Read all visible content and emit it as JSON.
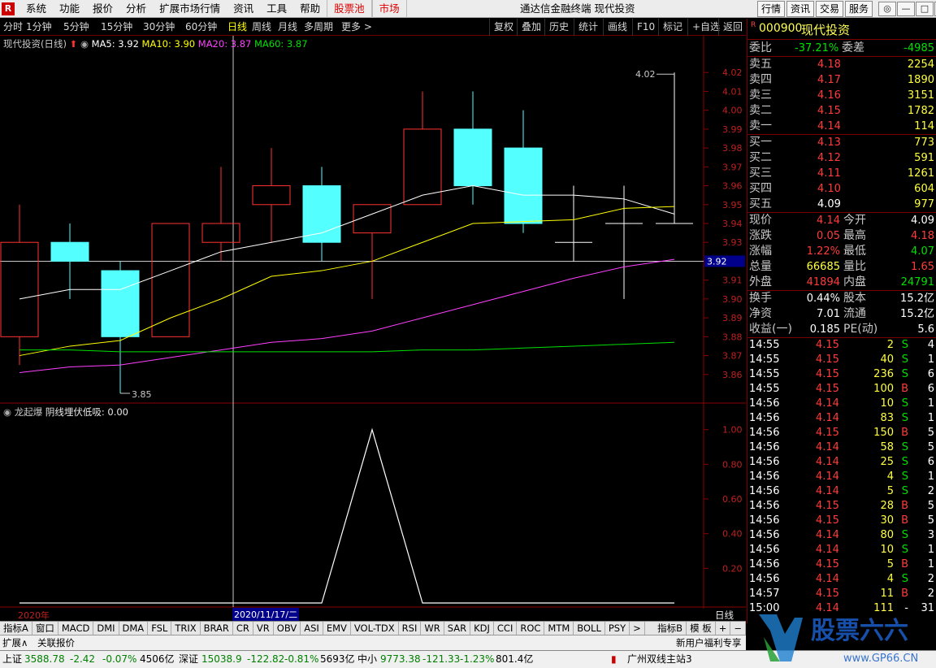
{
  "app": {
    "logo": "R",
    "title": "通达信金融终端  现代投资",
    "menu": [
      "系统",
      "功能",
      "报价",
      "分析",
      "扩展市场行情",
      "资讯",
      "工具",
      "帮助"
    ],
    "menu_red": [
      "股票池",
      "市场"
    ],
    "right_tabs": [
      "行情",
      "资讯",
      "交易",
      "服务"
    ],
    "window_buttons": [
      "◎",
      "—",
      "□",
      "✕"
    ]
  },
  "toolbar": {
    "periods": [
      "分时",
      "1分钟",
      "5分钟",
      "15分钟",
      "30分钟",
      "60分钟",
      "日线",
      "周线",
      "月线",
      "多周期",
      "更多 >"
    ],
    "active_period": "日线",
    "tools": [
      "复权",
      "叠加",
      "历史",
      "统计",
      "画线",
      "F10",
      "标记",
      "+自选",
      "返回"
    ]
  },
  "chart_header": {
    "name": "现代投资(日线)",
    "ma5": "MA5: 3.92",
    "ma10": "MA10: 3.90",
    "ma20": "MA20: 3.87",
    "ma60": "MA60: 3.87",
    "colors": {
      "ma5": "#ffffff",
      "ma10": "#ffff00",
      "ma20": "#ff40ff",
      "ma60": "#00e000",
      "up": "#ff3232",
      "down": "#54ffff"
    }
  },
  "indicator_header": {
    "name": "龙起爆",
    "label": "阴线埋伏低吸: 0.00"
  },
  "chart_data": [
    {
      "type": "candlestick",
      "title": "现代投资(日线)",
      "ylim": [
        3.85,
        4.03
      ],
      "y_ticks": [
        "4.02",
        "4.01",
        "4.00",
        "3.99",
        "3.98",
        "3.97",
        "3.96",
        "3.95",
        "3.94",
        "3.93",
        "3.92",
        "3.91",
        "3.90",
        "3.89",
        "3.88",
        "3.87",
        "3.86"
      ],
      "current_price_label": "3.92",
      "max_label": "4.02",
      "min_label": "3.85",
      "candles": [
        {
          "o": 3.88,
          "h": 3.95,
          "l": 3.865,
          "c": 3.93
        },
        {
          "o": 3.93,
          "h": 3.94,
          "l": 3.9,
          "c": 3.92
        },
        {
          "o": 3.915,
          "h": 3.92,
          "l": 3.85,
          "c": 3.88
        },
        {
          "o": 3.88,
          "h": 3.94,
          "l": 3.88,
          "c": 3.94
        },
        {
          "o": 3.93,
          "h": 3.97,
          "l": 3.92,
          "c": 3.94
        },
        {
          "o": 3.95,
          "h": 3.98,
          "l": 3.93,
          "c": 3.96
        },
        {
          "o": 3.96,
          "h": 3.97,
          "l": 3.92,
          "c": 3.93
        },
        {
          "o": 3.935,
          "h": 3.95,
          "l": 3.9,
          "c": 3.95
        },
        {
          "o": 3.95,
          "h": 4.01,
          "l": 3.95,
          "c": 3.99
        },
        {
          "o": 3.99,
          "h": 4.01,
          "l": 3.95,
          "c": 3.96
        },
        {
          "o": 3.98,
          "h": 4.0,
          "l": 3.935,
          "c": 3.94
        },
        {
          "o": 3.93,
          "h": 3.96,
          "l": 3.92,
          "c": 3.93
        },
        {
          "o": 3.94,
          "h": 3.96,
          "l": 3.9,
          "c": 3.94
        },
        {
          "o": 3.94,
          "h": 4.02,
          "l": 3.94,
          "c": 3.94
        }
      ],
      "ma5": [
        3.9,
        3.905,
        3.905,
        3.915,
        3.925,
        3.93,
        3.935,
        3.945,
        3.955,
        3.96,
        3.955,
        3.955,
        3.953,
        3.945
      ],
      "ma10": [
        3.87,
        3.875,
        3.878,
        3.89,
        3.9,
        3.912,
        3.915,
        3.92,
        3.93,
        3.94,
        3.941,
        3.942,
        3.948,
        3.949
      ],
      "ma20": [
        3.861,
        3.864,
        3.865,
        3.869,
        3.873,
        3.877,
        3.879,
        3.883,
        3.89,
        3.897,
        3.904,
        3.911,
        3.917,
        3.921
      ],
      "ma60": [
        3.873,
        3.873,
        3.872,
        3.872,
        3.872,
        3.872,
        3.872,
        3.872,
        3.873,
        3.873,
        3.874,
        3.875,
        3.876,
        3.877
      ]
    },
    {
      "type": "line",
      "title": "龙起爆",
      "series": [
        {
          "name": "阴线埋伏低吸",
          "values": [
            0,
            0,
            0,
            0,
            0,
            0,
            0,
            1,
            0,
            0,
            0,
            0,
            0,
            0
          ]
        }
      ],
      "ylim": [
        0,
        1.05
      ],
      "y_ticks": [
        "1.00",
        "0.80",
        "0.60",
        "0.40",
        "0.20"
      ]
    }
  ],
  "date_labels": {
    "year": "2020年",
    "cursor_date": "2020/11/17/二",
    "period": "日线"
  },
  "quote": {
    "code": "000900",
    "name": "现代投资",
    "badge": "R",
    "weibi_label": "委比",
    "weibi": "-37.21%",
    "weicha_label": "委差",
    "weicha": "-4985",
    "sell": [
      {
        "label": "卖五",
        "price": "4.18",
        "vol": "2254"
      },
      {
        "label": "卖四",
        "price": "4.17",
        "vol": "1890"
      },
      {
        "label": "卖三",
        "price": "4.16",
        "vol": "3151"
      },
      {
        "label": "卖二",
        "price": "4.15",
        "vol": "1782"
      },
      {
        "label": "卖一",
        "price": "4.14",
        "vol": "114"
      }
    ],
    "buy": [
      {
        "label": "买一",
        "price": "4.13",
        "vol": "773"
      },
      {
        "label": "买二",
        "price": "4.12",
        "vol": "591"
      },
      {
        "label": "买三",
        "price": "4.11",
        "vol": "1261"
      },
      {
        "label": "买四",
        "price": "4.10",
        "vol": "604"
      },
      {
        "label": "买五",
        "price": "4.09",
        "vol": "977"
      }
    ],
    "stats": [
      {
        "l1": "现价",
        "v1": "4.14",
        "c1": "red",
        "l2": "今开",
        "v2": "4.09",
        "c2": "wht"
      },
      {
        "l1": "涨跌",
        "v1": "0.05",
        "c1": "red",
        "l2": "最高",
        "v2": "4.18",
        "c2": "red"
      },
      {
        "l1": "涨幅",
        "v1": "1.22%",
        "c1": "red",
        "l2": "最低",
        "v2": "4.07",
        "c2": "green"
      },
      {
        "l1": "总量",
        "v1": "66685",
        "c1": "yel",
        "l2": "量比",
        "v2": "1.65",
        "c2": "red"
      },
      {
        "l1": "外盘",
        "v1": "41894",
        "c1": "red",
        "l2": "内盘",
        "v2": "24791",
        "c2": "green"
      }
    ],
    "stats2": [
      {
        "l1": "换手",
        "v1": "0.44%",
        "l2": "股本",
        "v2": "15.2亿"
      },
      {
        "l1": "净资",
        "v1": "7.01",
        "l2": "流通",
        "v2": "15.2亿"
      },
      {
        "l1": "收益(一)",
        "v1": "0.185",
        "l2": "PE(动)",
        "v2": "5.6"
      }
    ],
    "ticks": [
      {
        "t": "14:55",
        "p": "4.15",
        "v": "2",
        "s": "S",
        "n": "4"
      },
      {
        "t": "14:55",
        "p": "4.15",
        "v": "40",
        "s": "S",
        "n": "1"
      },
      {
        "t": "14:55",
        "p": "4.15",
        "v": "236",
        "s": "S",
        "n": "6"
      },
      {
        "t": "14:55",
        "p": "4.15",
        "v": "100",
        "s": "B",
        "n": "6"
      },
      {
        "t": "14:56",
        "p": "4.14",
        "v": "10",
        "s": "S",
        "n": "1"
      },
      {
        "t": "14:56",
        "p": "4.14",
        "v": "83",
        "s": "S",
        "n": "1"
      },
      {
        "t": "14:56",
        "p": "4.15",
        "v": "150",
        "s": "B",
        "n": "5"
      },
      {
        "t": "14:56",
        "p": "4.14",
        "v": "58",
        "s": "S",
        "n": "5"
      },
      {
        "t": "14:56",
        "p": "4.14",
        "v": "25",
        "s": "S",
        "n": "6"
      },
      {
        "t": "14:56",
        "p": "4.14",
        "v": "4",
        "s": "S",
        "n": "1"
      },
      {
        "t": "14:56",
        "p": "4.14",
        "v": "5",
        "s": "S",
        "n": "2"
      },
      {
        "t": "14:56",
        "p": "4.15",
        "v": "28",
        "s": "B",
        "n": "5"
      },
      {
        "t": "14:56",
        "p": "4.15",
        "v": "30",
        "s": "B",
        "n": "5"
      },
      {
        "t": "14:56",
        "p": "4.14",
        "v": "80",
        "s": "S",
        "n": "3"
      },
      {
        "t": "14:56",
        "p": "4.14",
        "v": "10",
        "s": "S",
        "n": "1"
      },
      {
        "t": "14:56",
        "p": "4.15",
        "v": "5",
        "s": "B",
        "n": "1"
      },
      {
        "t": "14:56",
        "p": "4.14",
        "v": "4",
        "s": "S",
        "n": "2"
      },
      {
        "t": "14:57",
        "p": "4.15",
        "v": "11",
        "s": "B",
        "n": "2"
      },
      {
        "t": "15:00",
        "p": "4.14",
        "v": "111",
        "s": "-",
        "n": "31"
      }
    ]
  },
  "indicator_tabs": [
    "指标A",
    "窗口",
    "MACD",
    "DMI",
    "DMA",
    "FSL",
    "TRIX",
    "BRAR",
    "CR",
    "VR",
    "OBV",
    "ASI",
    "EMV",
    "VOL-TDX",
    "RSI",
    "WR",
    "SAR",
    "KDJ",
    "CCI",
    "ROC",
    "MTM",
    "BOLL",
    "PSY",
    ">"
  ],
  "indicator_tabs_right": [
    "指标B",
    "模 板",
    "+",
    "−"
  ],
  "extbar": {
    "expand": "扩展∧",
    "related": "关联报价",
    "news": "新用户福利专享"
  },
  "status": {
    "sh_label": "上证",
    "sh_val": "3588.78",
    "sh_chg": "-2.42",
    "sh_pct": "-0.07%",
    "sh_amt": "4506亿",
    "sz_label": "深证",
    "sz_val": "15038.9",
    "sz_chg": "-122.82",
    "sz_pct": "-0.81%",
    "sz_amt": "5693亿",
    "zx_label": "中小",
    "zx_val": "9773.38",
    "zx_chg": "-121.33",
    "zx_pct": "-1.23%",
    "zx_amt": "801.4亿",
    "server": "广州双线主站3"
  },
  "watermark": {
    "brand": "股票六六",
    "url": "www.GP66.CN"
  }
}
